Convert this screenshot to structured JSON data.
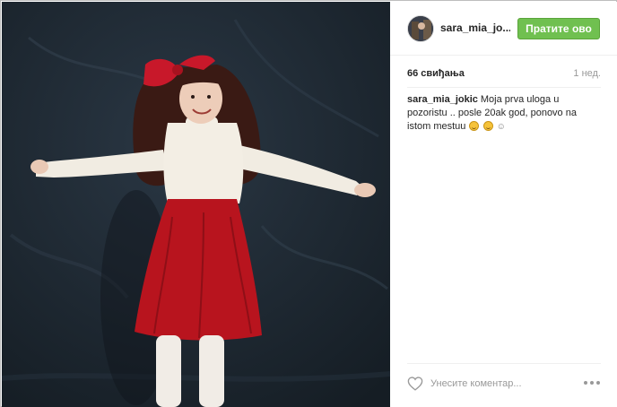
{
  "post": {
    "username": "sara_mia_jo...",
    "follow_label": "Пратите ово",
    "likes": "66 свиђања",
    "age": "1 нед.",
    "caption": {
      "username": "sara_mia_jokic",
      "text": "Moja prva uloga u pozoristu .. posle 20ak god, ponovo na istom mestuu",
      "trailing_symbol": "☺"
    },
    "comment_placeholder": "Унесите коментар...",
    "photo": {
      "description_icon": "photo-icon"
    }
  },
  "colors": {
    "follow_button": "#70c050",
    "backdrop": "#1c2730",
    "skirt": "#b8141e",
    "bow": "#c8182a"
  },
  "icons": {
    "like": "heart-icon",
    "options": "more-icon"
  }
}
